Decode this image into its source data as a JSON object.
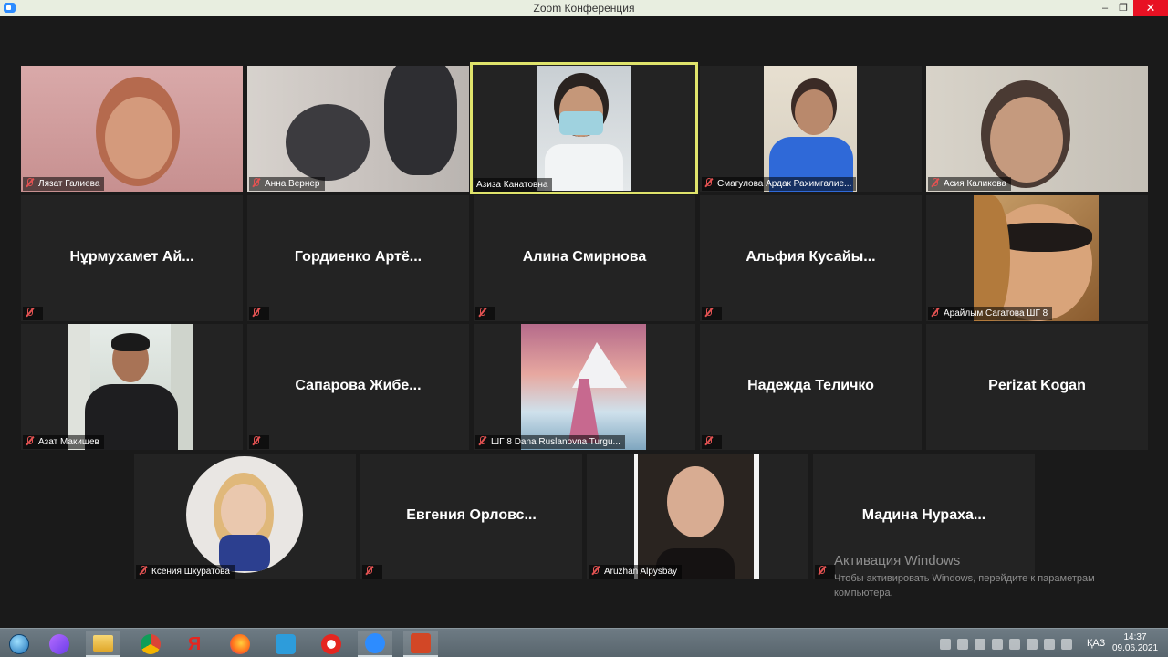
{
  "window": {
    "title": "Zoom Конференция",
    "minimize": "‒",
    "maximize": "❐",
    "close": "✕"
  },
  "participants": {
    "r1": [
      {
        "label": "Лязат Галиева"
      },
      {
        "label": "Анна Вернер"
      },
      {
        "label": "Азиза Канатовна"
      },
      {
        "label": "Смагулова Ардак Рахимгалие..."
      },
      {
        "label": "Асия Каликова"
      }
    ],
    "r2": [
      {
        "name": "Нұрмухамет Ай..."
      },
      {
        "name": "Гордиенко Артё..."
      },
      {
        "name": "Алина Смирнова"
      },
      {
        "name": "Альфия Кусайы..."
      },
      {
        "label": "Арайлым Сагатова ШГ 8"
      }
    ],
    "r3": [
      {
        "label": "Азат Макишев"
      },
      {
        "name": "Сапарова Жибе..."
      },
      {
        "label": "ШГ 8 Dana Ruslanovna Turgu..."
      },
      {
        "name": "Надежда Теличко"
      },
      {
        "name": "Perizat Kogan"
      }
    ],
    "r4": [
      {
        "label": "Ксения Шкуратова"
      },
      {
        "name": "Евгения Орловс..."
      },
      {
        "label": "Aruzhan Alpysbay"
      },
      {
        "name": "Мадина Нураха..."
      }
    ]
  },
  "activation": {
    "heading": "Активация Windows",
    "line1": "Чтобы активировать Windows, перейдите к параметрам",
    "line2": "компьютера."
  },
  "taskbar": {
    "language": "ҚАЗ",
    "time": "14:37",
    "date": "09.06.2021",
    "apps": [
      "start-orb-icon",
      "alice-icon",
      "file-explorer-icon",
      "chrome-icon",
      "yandex-icon",
      "firefox-icon",
      "video-icon",
      "yandex-browser-icon",
      "zoom-icon",
      "powerpoint-icon"
    ]
  },
  "colors": {
    "active_speaker_border": "#dfe36b",
    "muted_mic": "#e25252",
    "tile_bg": "#232323"
  }
}
